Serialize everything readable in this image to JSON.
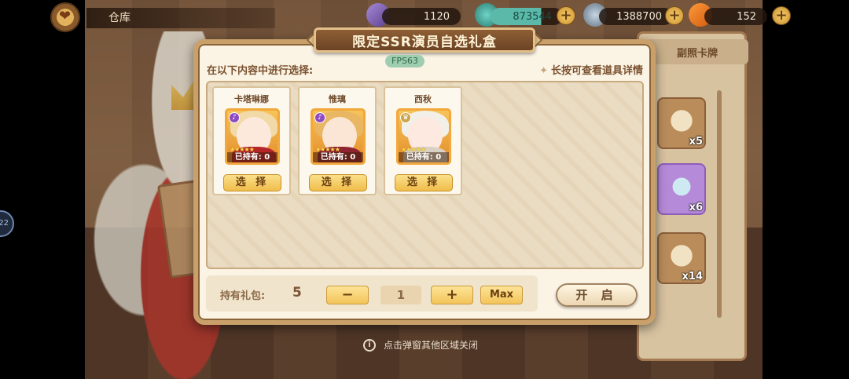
{
  "hud": {
    "location": "仓库",
    "currency_1": "1120",
    "currency_2": "873544",
    "currency_3": "1388700",
    "currency_4": "152",
    "plus": "+"
  },
  "background": {
    "side_tab": "副照卡牌",
    "side_counts": [
      "x5",
      "x6",
      "x14"
    ]
  },
  "dialog": {
    "title": "限定SSR演员自选礼盒",
    "fps": "FPS63",
    "instruction": "在以下内容中进行选择:",
    "hint": "长按可查看道具详情",
    "cards": [
      {
        "name": "卡塔琳娜",
        "owned": "已持有: 0",
        "button": "选 择",
        "type_icon": "key"
      },
      {
        "name": "惟璃",
        "owned": "已持有: 0",
        "button": "选 择",
        "type_icon": "key"
      },
      {
        "name": "西秋",
        "owned": "已持有: 0",
        "button": "选 择",
        "type_icon": "crown"
      }
    ],
    "own_label": "持有礼包:",
    "own_count": "5",
    "minus": "−",
    "quantity": "1",
    "plus": "+",
    "max": "Max",
    "open": "开 启"
  },
  "close_hint": "点击弹窗其他区域关闭",
  "side_bubble": "22",
  "colors": {
    "dialog_bg": "#fbf3e4",
    "header_bg": "#7d5130",
    "button_gold": "#f0bd4a",
    "text_brown": "#7a5230"
  }
}
